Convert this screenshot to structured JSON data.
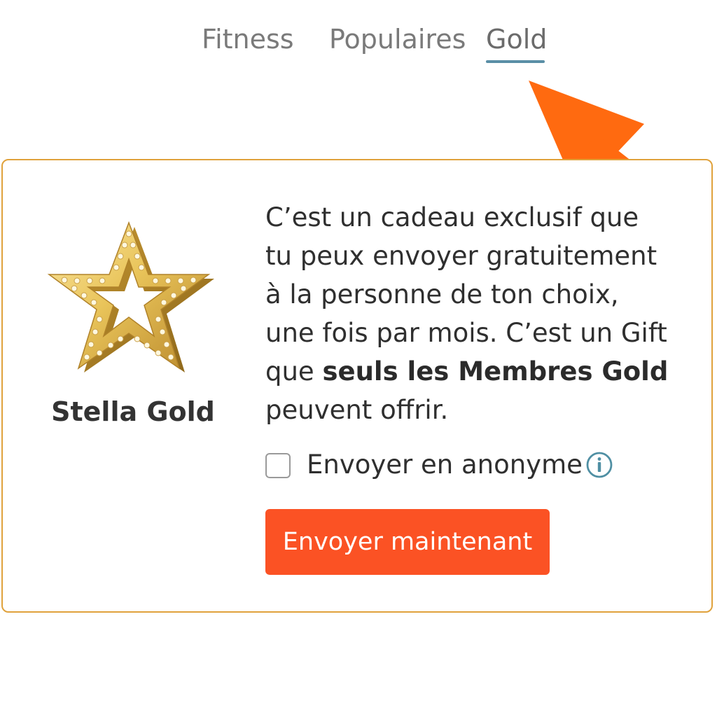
{
  "tabs": [
    {
      "label": "Fitness",
      "active": false
    },
    {
      "label": "Populaires",
      "active": false
    },
    {
      "label": "Gold",
      "active": true
    }
  ],
  "gift": {
    "name": "Stella Gold",
    "icon": "gold-star-icon",
    "description": {
      "line1": "C’est un cadeau exclusif que",
      "line2": "tu peux envoyer gratuitement",
      "line3": "à la personne de ton choix,",
      "line4": "une fois par mois. C’est un Gift",
      "line5_prefix": "que ",
      "line5_bold": "seuls les Membres Gold",
      "line6": "peuvent offrir."
    }
  },
  "anonymous": {
    "label": "Envoyer en anonyme",
    "checked": false
  },
  "send_button": {
    "label": "Envoyer maintenant"
  },
  "colors": {
    "accent_orange": "#fb5224",
    "card_border": "#e0a23c",
    "tab_underline": "#5a8fa6",
    "pointer_arrow": "#ff6a10"
  }
}
